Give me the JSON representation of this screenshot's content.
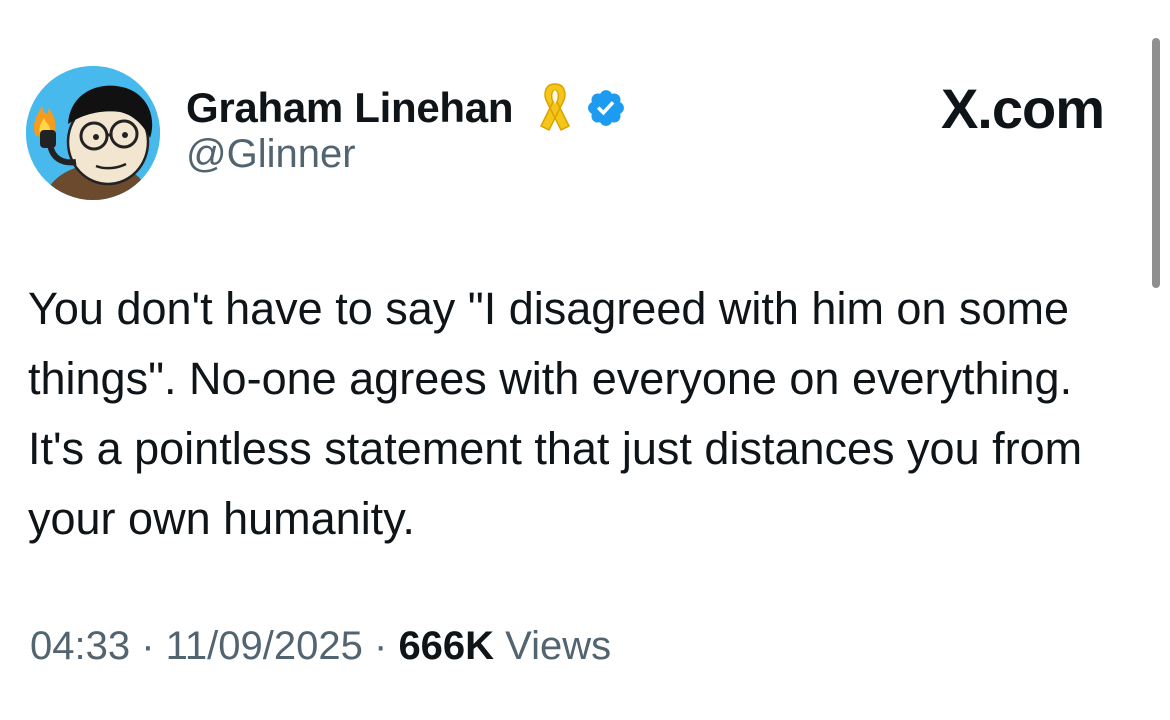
{
  "author": {
    "display_name": "Graham Linehan",
    "handle": "@Glinner",
    "avatar_icon": "cartoon-portrait-avatar",
    "badges": [
      "yellow-ribbon-icon",
      "verified-check-icon"
    ]
  },
  "source": {
    "label": "X.com"
  },
  "tweet": {
    "text": "You don't have to say \"I disagreed with him on some things\". No-one agrees with everyone on everything. It's a pointless statement that just distances you from your own humanity."
  },
  "meta": {
    "time": "04:33",
    "separator": " · ",
    "date": "11/09/2025",
    "views_count": "666K",
    "views_label": " Views"
  },
  "colors": {
    "text_primary": "#0f1419",
    "text_secondary": "#536471",
    "verified_blue": "#1d9bf0",
    "ribbon_yellow": "#f5c518"
  }
}
